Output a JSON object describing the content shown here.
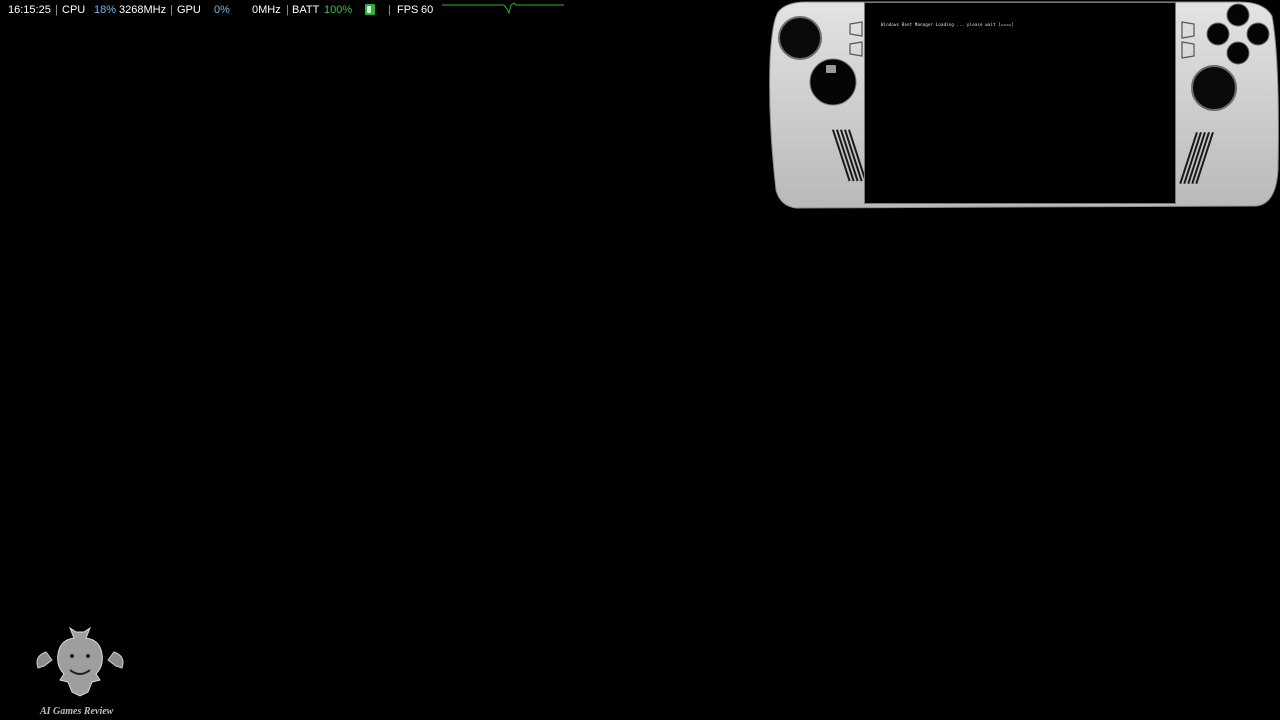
{
  "osd": {
    "time": "16:15:25",
    "cpu_label": "CPU",
    "cpu_load": "18%",
    "cpu_clock": "3268MHz",
    "gpu_label": "GPU",
    "gpu_load": "0%",
    "gpu_clock": "0MHz",
    "batt_label": "BATT",
    "batt_level": "100%",
    "fps_label": "FPS",
    "fps_value": "60",
    "separator": "|"
  },
  "device": {
    "screen_text": "Windows Boot Manager  Loading  ...  please wait  [====]"
  },
  "watermark": {
    "text": "AI Games Review"
  },
  "colors": {
    "background": "#000000",
    "accent_blue": "#6fb7e8",
    "accent_green": "#39c24a",
    "device_shell": "#cfcfcf"
  }
}
